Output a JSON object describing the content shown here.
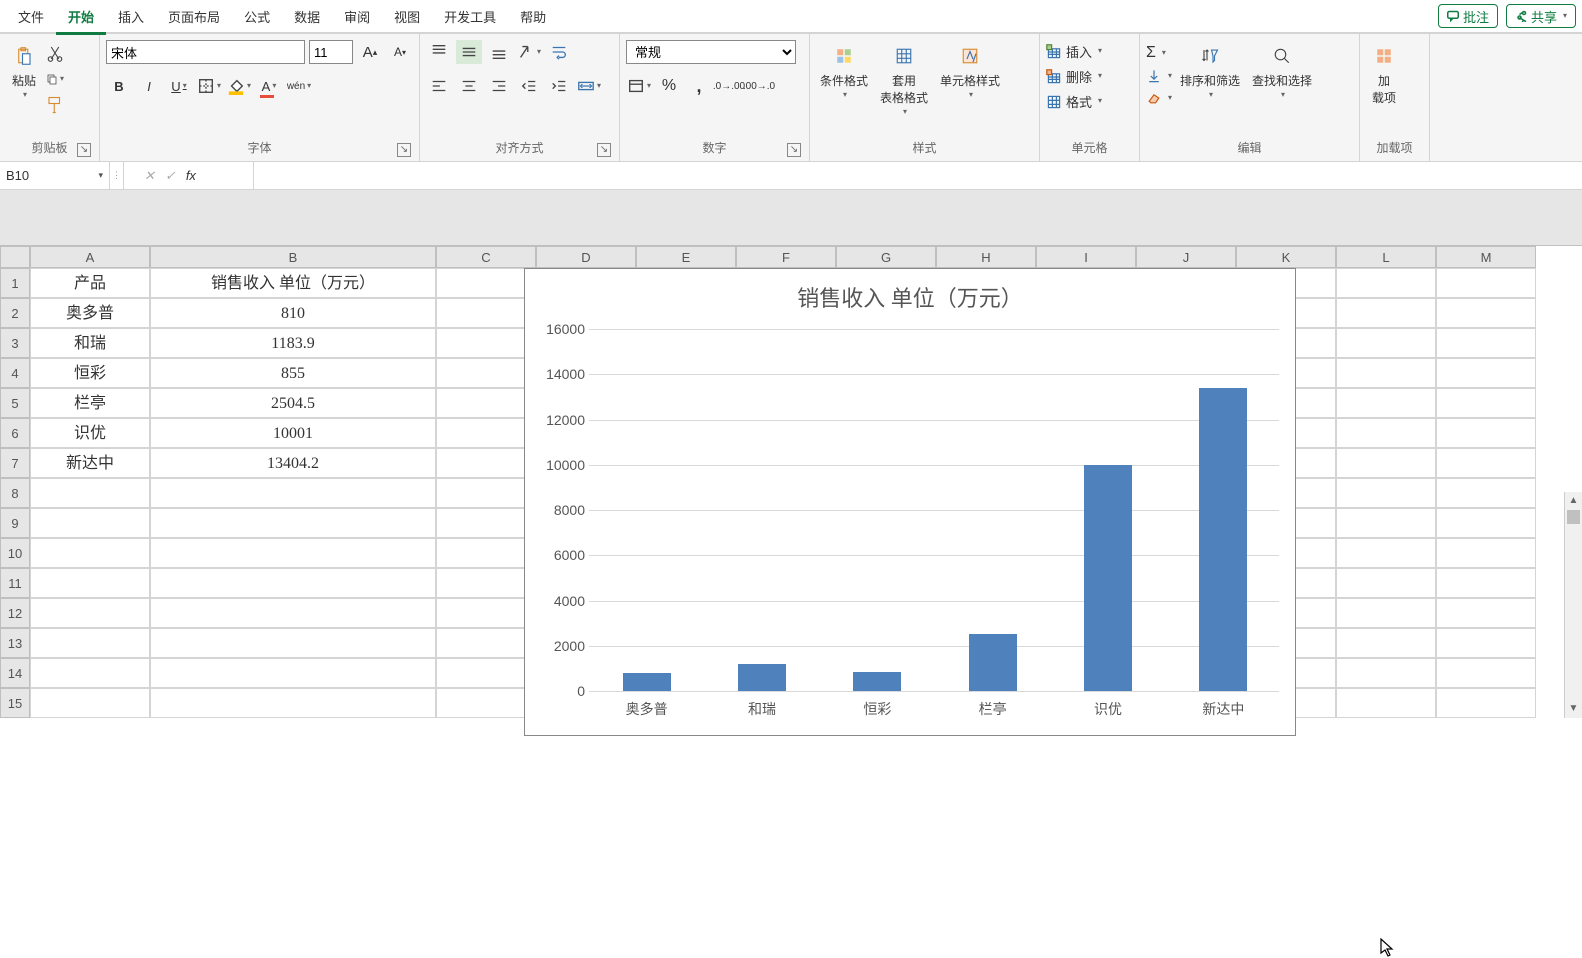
{
  "menu": {
    "tabs": [
      "文件",
      "开始",
      "插入",
      "页面布局",
      "公式",
      "数据",
      "审阅",
      "视图",
      "开发工具",
      "帮助"
    ],
    "active_index": 1,
    "comment_btn": "批注",
    "share_btn": "共享"
  },
  "ribbon": {
    "clipboard": {
      "paste": "粘贴",
      "label": "剪贴板"
    },
    "font": {
      "name": "宋体",
      "size": "11",
      "grow_icon": "A↑",
      "shrink_icon": "A↓",
      "bold": "B",
      "italic": "I",
      "underline": "U",
      "phonetic": "wén",
      "label": "字体"
    },
    "align": {
      "label": "对齐方式"
    },
    "number": {
      "format": "常规",
      "label": "数字"
    },
    "styles": {
      "cond": "条件格式",
      "table": "套用\n表格格式",
      "cell": "单元格样式",
      "label": "样式"
    },
    "cells": {
      "insert": "插入",
      "delete": "删除",
      "format": "格式",
      "label": "单元格"
    },
    "editing": {
      "sortfilter": "排序和筛选",
      "find": "查找和选择",
      "label": "编辑"
    },
    "addins": {
      "addin": "加\n载项",
      "label": "加载项"
    }
  },
  "formula_bar": {
    "namebox": "B10",
    "fx": "fx"
  },
  "sheet": {
    "columns": [
      "A",
      "B",
      "C",
      "D",
      "E",
      "F",
      "G",
      "H",
      "I",
      "J",
      "K",
      "L",
      "M"
    ],
    "rows": [
      1,
      2,
      3,
      4,
      5,
      6,
      7,
      8,
      9,
      10,
      11,
      12,
      13,
      14,
      15
    ],
    "header": {
      "A": "产品",
      "B": "销售收入 单位（万元）"
    },
    "data": [
      {
        "A": "奥多普",
        "B": "810"
      },
      {
        "A": "和瑞",
        "B": "1183.9"
      },
      {
        "A": "恒彩",
        "B": "855"
      },
      {
        "A": "栏亭",
        "B": "2504.5"
      },
      {
        "A": "识优",
        "B": "10001"
      },
      {
        "A": "新达中",
        "B": "13404.2"
      }
    ]
  },
  "chart_data": {
    "type": "bar",
    "title": "销售收入 单位（万元）",
    "categories": [
      "奥多普",
      "和瑞",
      "恒彩",
      "栏亭",
      "识优",
      "新达中"
    ],
    "values": [
      810,
      1183.9,
      855,
      2504.5,
      10001,
      13404.2
    ],
    "ylim": [
      0,
      16000
    ],
    "yticks": [
      0,
      2000,
      4000,
      6000,
      8000,
      10000,
      12000,
      14000,
      16000
    ],
    "xlabel": "",
    "ylabel": ""
  }
}
